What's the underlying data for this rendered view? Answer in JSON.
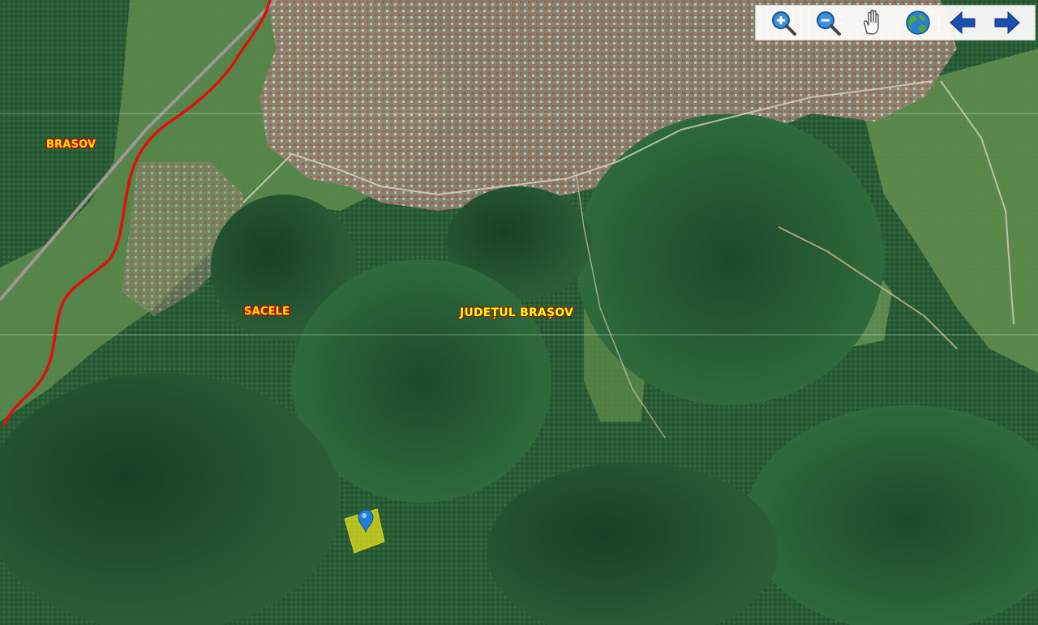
{
  "map": {
    "labels": {
      "brasov": "BRASOV",
      "sacele": "SACELE",
      "judet": "JUDEȚUL BRAȘOV"
    },
    "marker_icon": "location-pin-icon",
    "parcel_color": "#e5e21a",
    "boundary_color": "#e01010"
  },
  "toolbar": {
    "buttons": [
      {
        "icon": "zoom-in-icon"
      },
      {
        "icon": "zoom-out-icon"
      },
      {
        "icon": "pan-hand-icon"
      },
      {
        "icon": "globe-icon"
      },
      {
        "icon": "arrow-left-icon"
      },
      {
        "icon": "arrow-right-icon"
      }
    ]
  },
  "colors": {
    "forest_dark": "#1f4a2c",
    "forest_mid": "#2e6a3c",
    "meadow": "#5f8f4a",
    "town": "#8a8070",
    "roof": "#b0524a",
    "accent_blue": "#1a4fb0"
  }
}
